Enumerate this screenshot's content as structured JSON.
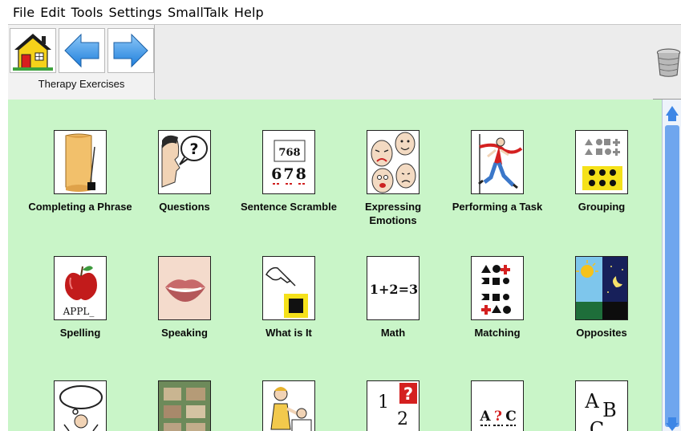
{
  "menu": [
    "File",
    "Edit",
    "Tools",
    "Settings",
    "SmallTalk",
    "Help"
  ],
  "toolbar": {
    "board_title": "Therapy Exercises",
    "home_icon": "home-icon",
    "back_icon": "arrow-left-icon",
    "forward_icon": "arrow-right-icon",
    "trash_icon": "trash-can-icon"
  },
  "colors": {
    "board_background": "#c9f5c8",
    "arrow_blue": "#2f8de4",
    "scroll_thumb": "#6fa6ee"
  },
  "board": {
    "row1": [
      {
        "label": "Completing a Phrase",
        "icon": "scroll-quill-icon"
      },
      {
        "label": "Questions",
        "icon": "question-speech-icon"
      },
      {
        "label": "Sentence Scramble",
        "icon": "number-scramble-icon"
      },
      {
        "label": "Expressing Emotions",
        "icon": "faces-emotions-icon"
      },
      {
        "label": "Performing a Task",
        "icon": "runner-finish-icon"
      },
      {
        "label": "Grouping",
        "icon": "grouping-shapes-icon"
      }
    ],
    "row2": [
      {
        "label": "Spelling",
        "icon": "apple-spelling-icon",
        "tile_text": "APPL_"
      },
      {
        "label": "Speaking",
        "icon": "lips-icon"
      },
      {
        "label": "What is It",
        "icon": "pointing-hand-icon"
      },
      {
        "label": "Math",
        "icon": "math-equation-icon",
        "tile_text": "1+2=3"
      },
      {
        "label": "Matching",
        "icon": "matching-shapes-icon"
      },
      {
        "label": "Opposites",
        "icon": "day-night-icon"
      }
    ],
    "row3": [
      {
        "label": "",
        "icon": "thinking-person-icon"
      },
      {
        "label": "",
        "icon": "rooms-icon"
      },
      {
        "label": "",
        "icon": "caregiver-icon"
      },
      {
        "label": "",
        "icon": "number-sequence-icon"
      },
      {
        "label": "",
        "icon": "letter-sequence-icon"
      },
      {
        "label": "",
        "icon": "alphabet-icon"
      }
    ]
  },
  "tile_text": {
    "scramble_top": "768",
    "scramble_bottom": "678",
    "sequence_a": "A",
    "sequence_q": "?",
    "sequence_c": "C",
    "numbers_1": "1",
    "numbers_2": "2",
    "numbers_q": "?",
    "alpha_a": "A",
    "alpha_b": "B",
    "alpha_c": "C",
    "questions_q": "?"
  }
}
